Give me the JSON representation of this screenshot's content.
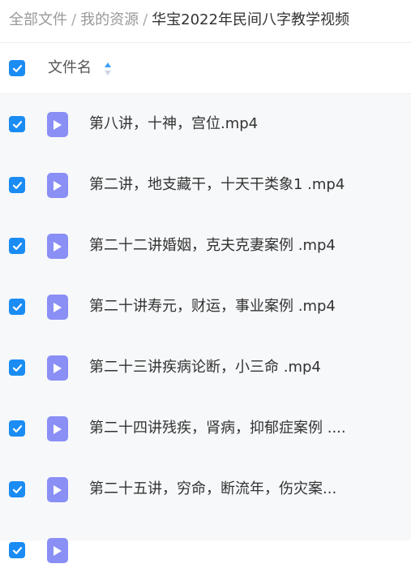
{
  "breadcrumb": {
    "items": [
      {
        "label": "全部文件"
      },
      {
        "label": "我的资源"
      }
    ],
    "separator": "/",
    "current": "华宝2022年民间八字教学视频"
  },
  "table": {
    "column_name": "文件名",
    "rows": [
      {
        "name": "第八讲，十神，宫位.mp4"
      },
      {
        "name": "第二讲，地支藏干，十天干类象1 .mp4"
      },
      {
        "name": "第二十二讲婚姻，克夫克妻案例 .mp4"
      },
      {
        "name": "第二十讲寿元，财运，事业案例 .mp4"
      },
      {
        "name": "第二十三讲疾病论断，小三命 .mp4"
      },
      {
        "name": "第二十四讲残疾，肾病，抑郁症案例 ...."
      },
      {
        "name": "第二十五讲，穷命，断流年，伤灾案..."
      },
      {
        "name": ""
      }
    ]
  },
  "colors": {
    "accent": "#1a8cf3",
    "video_icon": "#8a8ff5",
    "list_background": "#f7f8fa"
  },
  "icons": {
    "checkbox": "checkmark-icon",
    "file": "video-file-icon",
    "sort": "sort-icon"
  }
}
